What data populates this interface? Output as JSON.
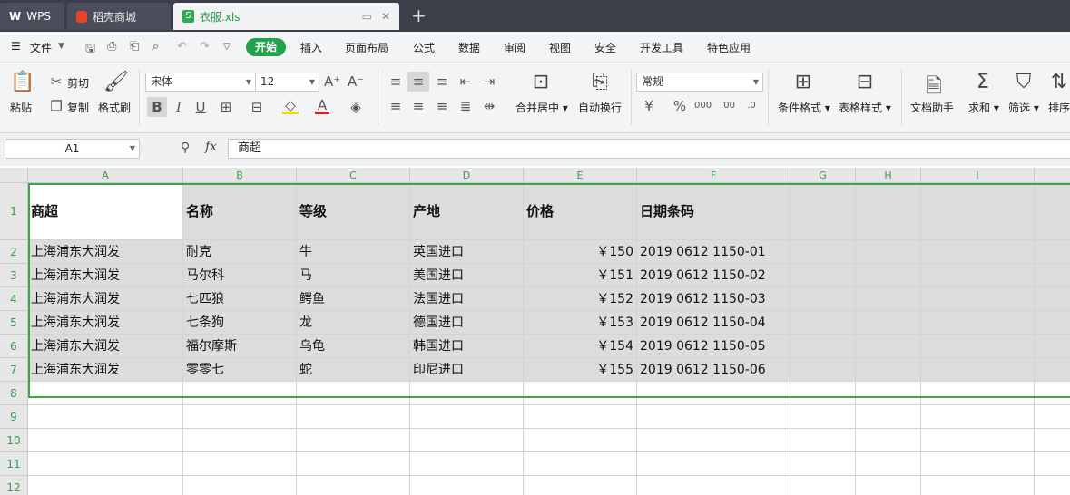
{
  "tabs": {
    "wps": "WPS",
    "daoke": "稻壳商城",
    "file": "衣服.xls",
    "new": "+"
  },
  "menu": {
    "file": "文件",
    "items": [
      "开始",
      "插入",
      "页面布局",
      "公式",
      "数据",
      "审阅",
      "视图",
      "安全",
      "开发工具",
      "特色应用"
    ]
  },
  "ribbon": {
    "paste": "粘贴",
    "cut": "剪切",
    "copy": "复制",
    "format_painter": "格式刷",
    "font": "宋体",
    "size": "12",
    "merge": "合并居中",
    "wrap": "自动换行",
    "number_format": "常规",
    "cond_format": "条件格式",
    "table_style": "表格样式",
    "doc_helper": "文档助手",
    "sum": "求和",
    "filter": "筛选",
    "sort": "排序"
  },
  "formula": {
    "cell_ref": "A1",
    "fx": "fx",
    "value": "商超"
  },
  "sheet": {
    "columns": [
      "A",
      "B",
      "C",
      "D",
      "E",
      "F",
      "G",
      "H",
      "I"
    ],
    "rows": [
      "1",
      "2",
      "3",
      "4",
      "5",
      "6",
      "7",
      "8",
      "9",
      "10",
      "11",
      "12"
    ],
    "header": [
      "商超",
      "名称",
      "等级",
      "产地",
      "价格",
      "日期条码"
    ],
    "data": [
      [
        "上海浦东大润发",
        "耐克",
        "牛",
        "英国进口",
        "￥150",
        "2019  0612  1150-01"
      ],
      [
        "上海浦东大润发",
        "马尔科",
        "马",
        "美国进口",
        "￥151",
        "2019  0612  1150-02"
      ],
      [
        "上海浦东大润发",
        "七匹狼",
        "鳄鱼",
        "法国进口",
        "￥152",
        "2019  0612  1150-03"
      ],
      [
        "上海浦东大润发",
        "七条狗",
        "龙",
        "德国进口",
        "￥153",
        "2019  0612  1150-04"
      ],
      [
        "上海浦东大润发",
        "福尔摩斯",
        "乌龟",
        "韩国进口",
        "￥154",
        "2019  0612  1150-05"
      ],
      [
        "上海浦东大润发",
        "零零七",
        "蛇",
        "印尼进口",
        "￥155",
        "2019  0612  1150-06"
      ]
    ]
  },
  "colors": {
    "accent": "#24a24b",
    "selection": "#3aa64d"
  }
}
